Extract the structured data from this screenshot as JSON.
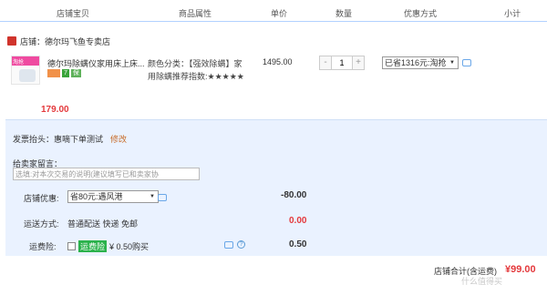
{
  "header": {
    "col_item": "店铺宝贝",
    "col_attr": "商品属性",
    "col_price": "单价",
    "col_qty": "数量",
    "col_discount": "优惠方式",
    "col_subtotal": "小计"
  },
  "shop": {
    "label": "店铺：",
    "name": "德尔玛飞鱼专卖店"
  },
  "item": {
    "thumb_text": "淘抢",
    "title": "德尔玛除螨仪家用床上床...",
    "badges": [
      "",
      "7",
      "保"
    ],
    "spec": "颜色分类：【强效除螨】家用除螨推荐指数:★★★★★",
    "price": "1495.00",
    "qty_minus": "-",
    "qty": "1",
    "qty_plus": "+",
    "coupon": "已省1316元:淘抢",
    "total": "179.00"
  },
  "invoice": {
    "label": "发票抬头：惠嘀下单测试",
    "edit": "修改"
  },
  "remark": {
    "label": "给卖家留言：",
    "placeholder": "选填:对本次交易的说明(建议填写已和卖家协"
  },
  "shop_discount": {
    "label": "店铺优惠:",
    "selected": "省80元:遇风港",
    "amount": "-80.00"
  },
  "shipping": {
    "label": "运送方式:",
    "value": "普通配送 快递 免邮",
    "amount": "0.00"
  },
  "insurance": {
    "label": "运费险:",
    "tag": "运费险",
    "text": "¥ 0.50购买",
    "amount": "0.50",
    "help": "?"
  },
  "footer": {
    "label": "店铺合计(含运费)",
    "total": "¥99.00"
  },
  "watermark": "什么值得买",
  "colors": {
    "accent_red": "#e4393c",
    "header_line": "#b2d1ff",
    "panel_bg": "#eaf2ff"
  }
}
